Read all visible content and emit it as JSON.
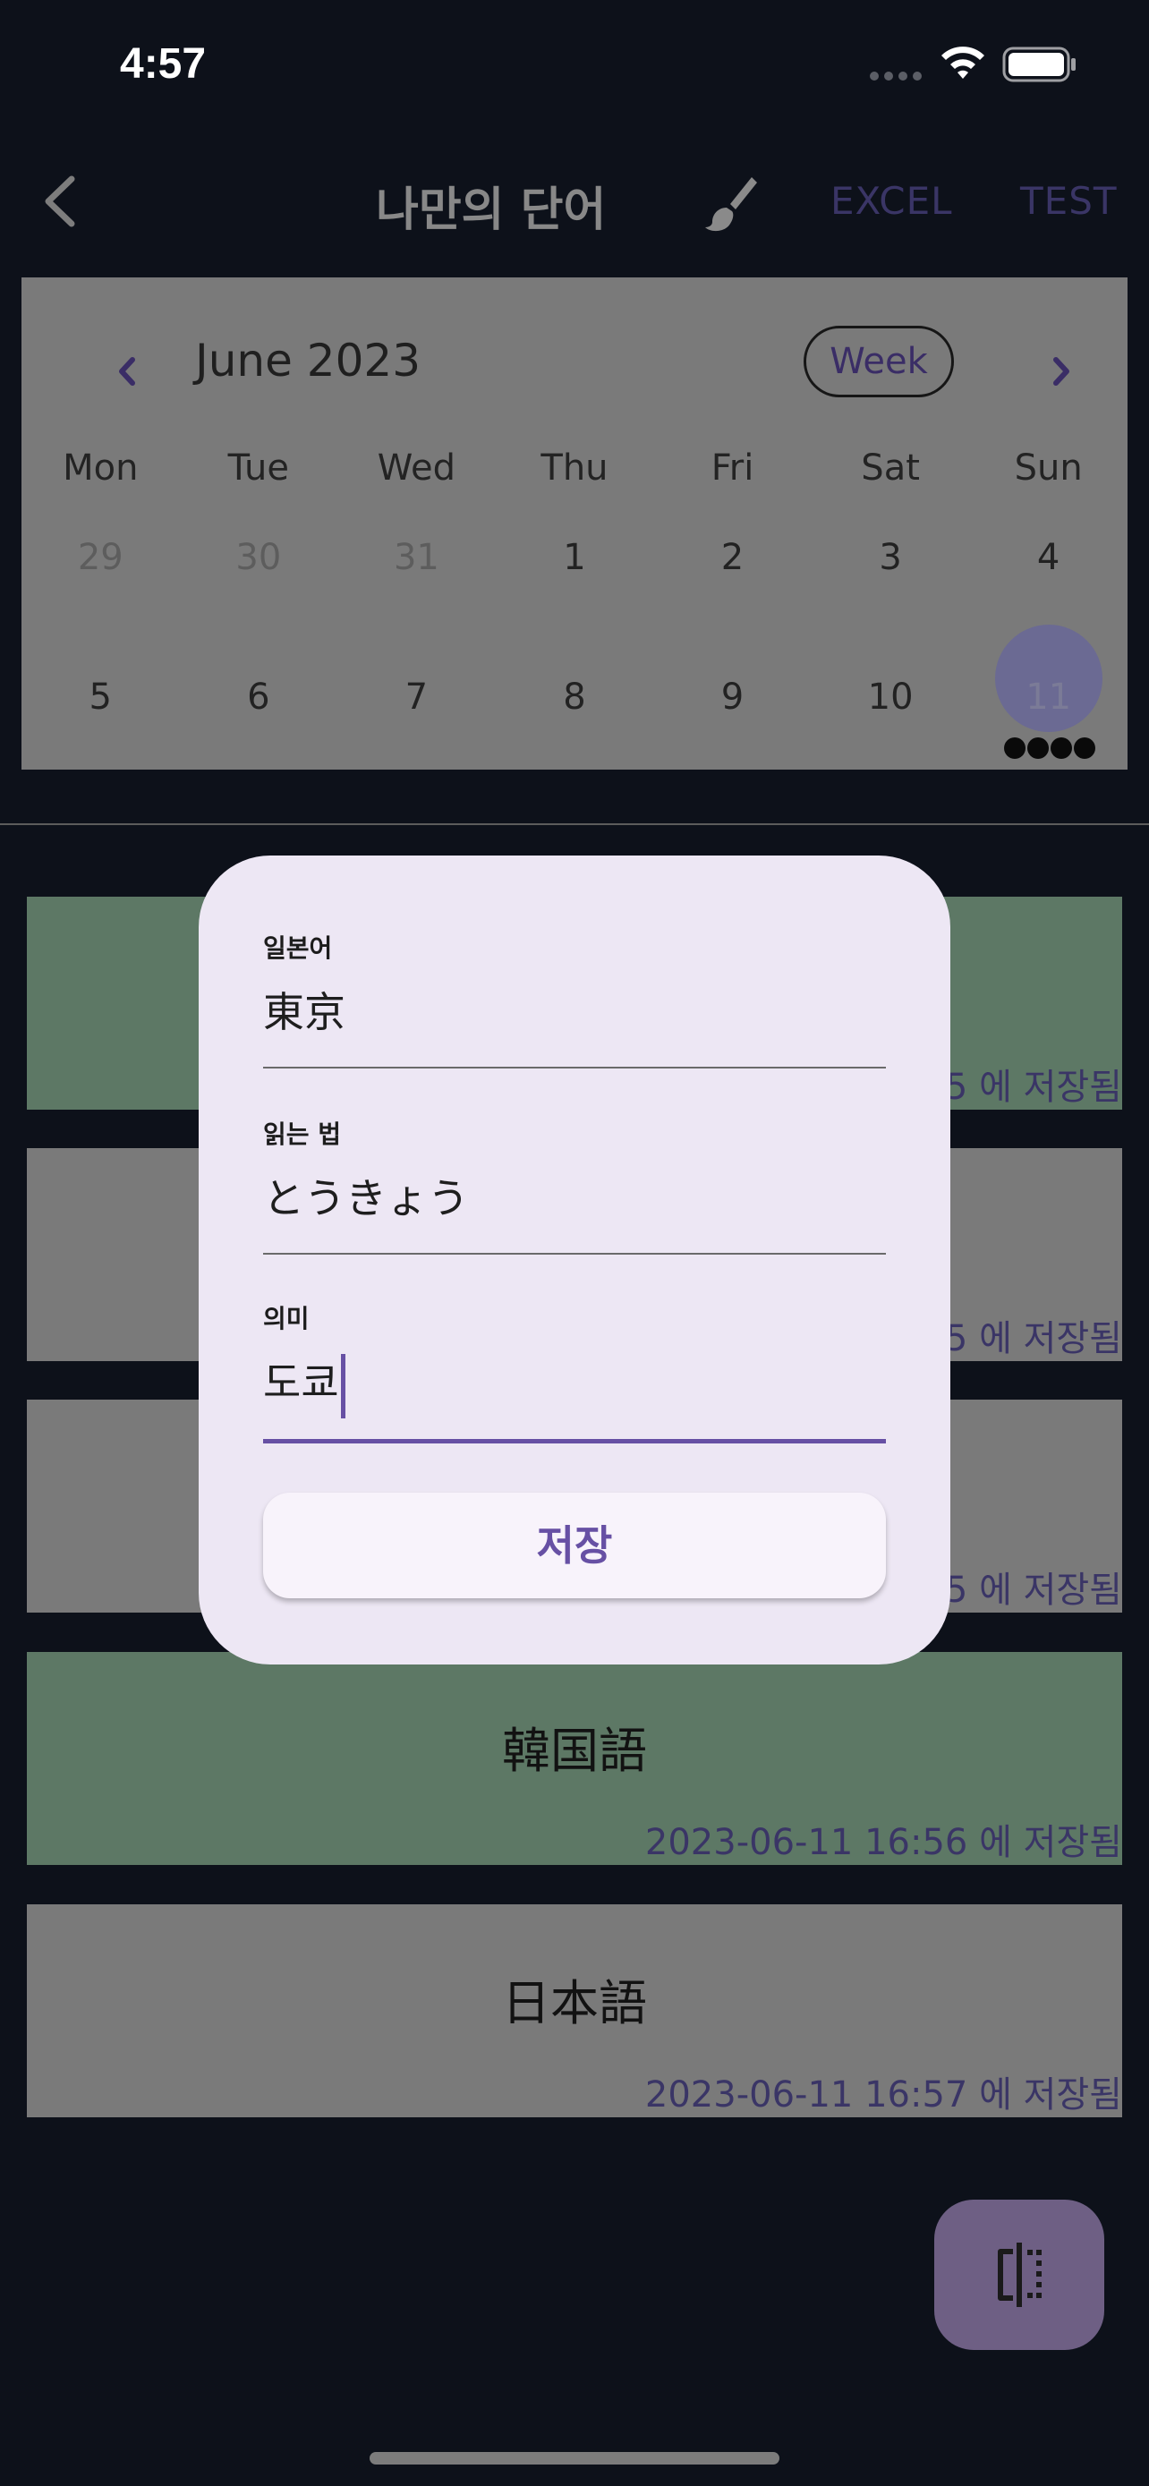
{
  "status_bar": {
    "time": "4:57"
  },
  "app_bar": {
    "title": "나만의 단어",
    "excel_label": "EXCEL",
    "test_label": "TEST"
  },
  "calendar": {
    "month_label": "June 2023",
    "format_button": "Week",
    "weekdays": [
      "Mon",
      "Tue",
      "Wed",
      "Thu",
      "Fri",
      "Sat",
      "Sun"
    ],
    "week1": [
      "29",
      "30",
      "31",
      "1",
      "2",
      "3",
      "4"
    ],
    "week2": [
      "5",
      "6",
      "7",
      "8",
      "9",
      "10",
      "11"
    ],
    "selected_day": "11",
    "event_marker_count": 4
  },
  "cards": [
    {
      "word": "",
      "saved": "5 에 저장됨",
      "color": "#5d7865"
    },
    {
      "word": "",
      "saved": "5 에 저장됨",
      "color": "#7a7a7a"
    },
    {
      "word": "",
      "saved": "5 에 저장됨",
      "color": "#7a7a7a"
    },
    {
      "word": "韓国語",
      "saved": "2023-06-11 16:56 에 저장됨",
      "color": "#5d7865"
    },
    {
      "word": "日本語",
      "saved": "2023-06-11 16:57 에 저장됨",
      "color": "#7a7a7a"
    }
  ],
  "dialog": {
    "japanese_label": "일본어",
    "japanese_value": "東京",
    "reading_label": "읽는 법",
    "reading_value": "とうきょう",
    "meaning_label": "의미",
    "meaning_value": "도쿄",
    "save_label": "저장"
  },
  "colors": {
    "accent": "#6750a4",
    "dialog_bg": "#ede7f4",
    "card_green": "#5d7865",
    "card_gray": "#7a7a7a"
  }
}
